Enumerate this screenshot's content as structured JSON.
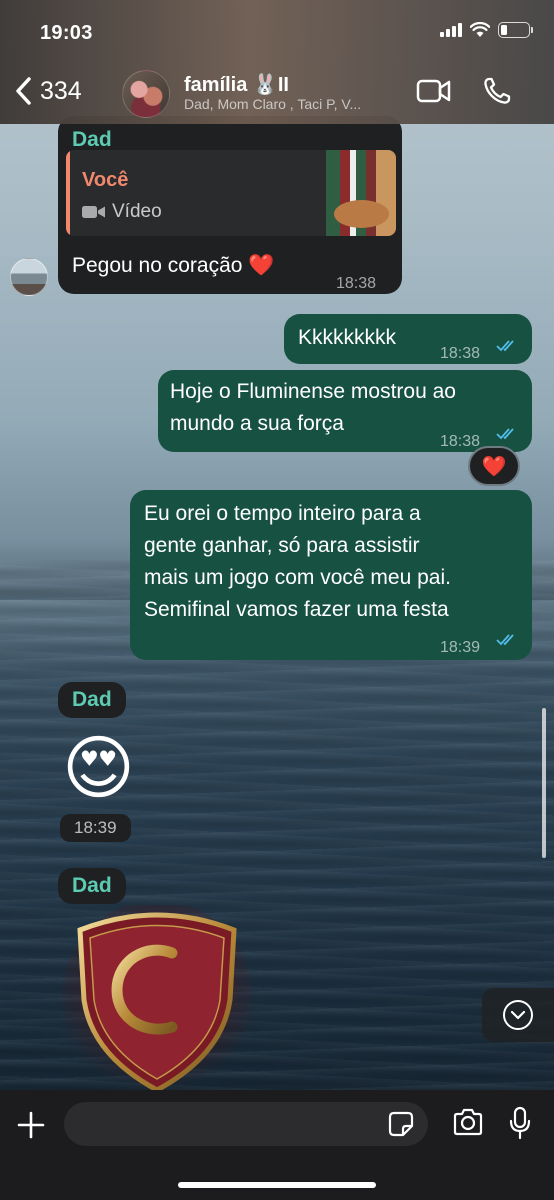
{
  "status_bar": {
    "time": "19:03"
  },
  "header": {
    "back_count": "334",
    "title": "família 🐰II",
    "subtitle": "Dad, Mom Claro , Taci P, V..."
  },
  "messages": {
    "m1": {
      "sender": "Dad",
      "quote_name": "Você",
      "quote_type": "Vídeo",
      "text": "Pegou no coração ❤️",
      "time": "18:38"
    },
    "m2": {
      "text": "Kkkkkkkkk",
      "time": "18:38"
    },
    "m3": {
      "line1": "Hoje o Fluminense mostrou ao",
      "line2": "mundo a sua força",
      "time": "18:38",
      "reaction": "❤️"
    },
    "m4": {
      "line1": "Eu orei o tempo inteiro para a",
      "line2": "gente ganhar, só para assistir",
      "line3": "mais um jogo com você meu pai.",
      "line4": "Semifinal vamos fazer uma festa",
      "time": "18:39"
    },
    "m5": {
      "sender": "Dad",
      "emoji": "😍",
      "time": "18:39"
    },
    "m6": {
      "sender": "Dad"
    }
  },
  "colors": {
    "incoming_bubble": "#1f2022",
    "outgoing_bubble": "#175142",
    "sender_name": "#5dcbb1",
    "quote_accent": "#f0886e",
    "read_ticks": "#53bdeb"
  },
  "icons": [
    "back-chevron-icon",
    "video-call-icon",
    "phone-icon",
    "video-camera-icon",
    "read-ticks-icon",
    "chevron-down-icon",
    "plus-icon",
    "sticker-icon",
    "camera-icon",
    "microphone-icon"
  ]
}
